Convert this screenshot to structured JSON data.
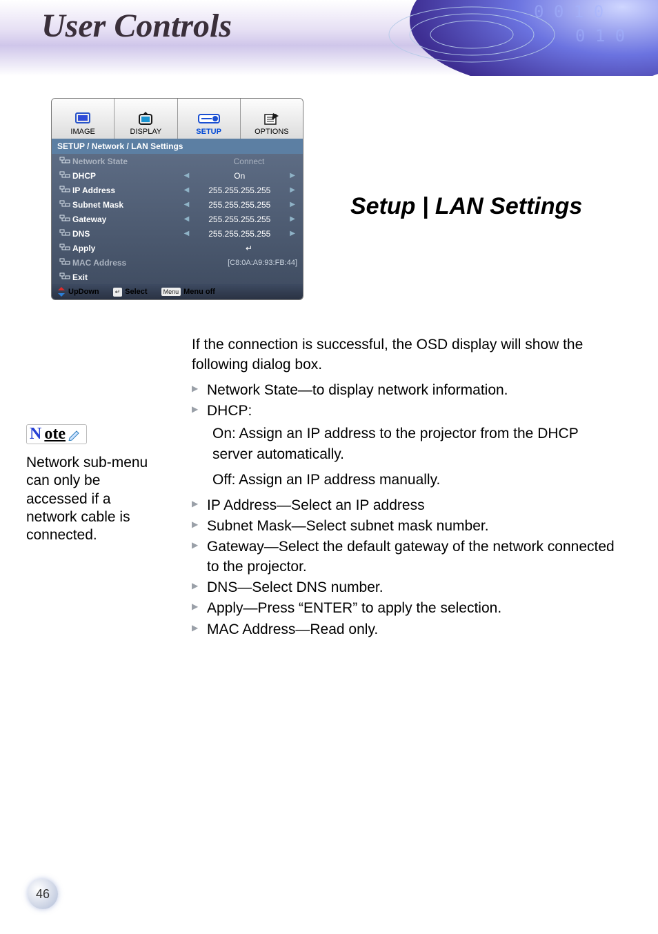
{
  "header": {
    "title": "User Controls"
  },
  "section_title": "Setup | LAN Settings",
  "osd": {
    "tabs": [
      {
        "label": "IMAGE"
      },
      {
        "label": "DISPLAY"
      },
      {
        "label": "SETUP"
      },
      {
        "label": "OPTIONS"
      }
    ],
    "breadcrumb": "SETUP / Network / LAN Settings",
    "rows": [
      {
        "label": "Network State",
        "value": "Connect",
        "muted": true,
        "arrows": false
      },
      {
        "label": "DHCP",
        "value": "On",
        "muted": false,
        "arrows": true
      },
      {
        "label": "IP Address",
        "value": "255.255.255.255",
        "muted": false,
        "arrows": true
      },
      {
        "label": "Subnet Mask",
        "value": "255.255.255.255",
        "muted": false,
        "arrows": true
      },
      {
        "label": "Gateway",
        "value": "255.255.255.255",
        "muted": false,
        "arrows": true
      },
      {
        "label": "DNS",
        "value": "255.255.255.255",
        "muted": false,
        "arrows": true
      },
      {
        "label": "Apply",
        "value": "↵",
        "muted": false,
        "arrows": false
      },
      {
        "label": "MAC Address",
        "value": "[C8:0A:A9:93:FB:44]",
        "muted": true,
        "arrows": false
      },
      {
        "label": "Exit",
        "value": "",
        "muted": false,
        "arrows": false
      }
    ],
    "footer": {
      "updown": "UpDown",
      "select_key": "↵",
      "select": "Select",
      "menu_key": "Menu",
      "menu_off": "Menu off"
    }
  },
  "note": {
    "label": "Note",
    "text": "Network sub-menu can only be accessed if a network cable is connected."
  },
  "content": {
    "intro": "If the connection is successful, the OSD display will show the following dialog box.",
    "items": [
      "Network State—to display network information.",
      "DHCP:",
      "IP Address—Select an IP address",
      "Subnet Mask—Select subnet mask number.",
      "Gateway—Select the default gateway of the network connected to the projector.",
      "DNS—Select DNS number.",
      "Apply—Press “ENTER” to apply the selection.",
      "MAC Address—Read only."
    ],
    "dhcp_on": "On: Assign an IP address to the projector from the DHCP server automatically.",
    "dhcp_off": "Off: Assign an IP address manually."
  },
  "page": "46"
}
